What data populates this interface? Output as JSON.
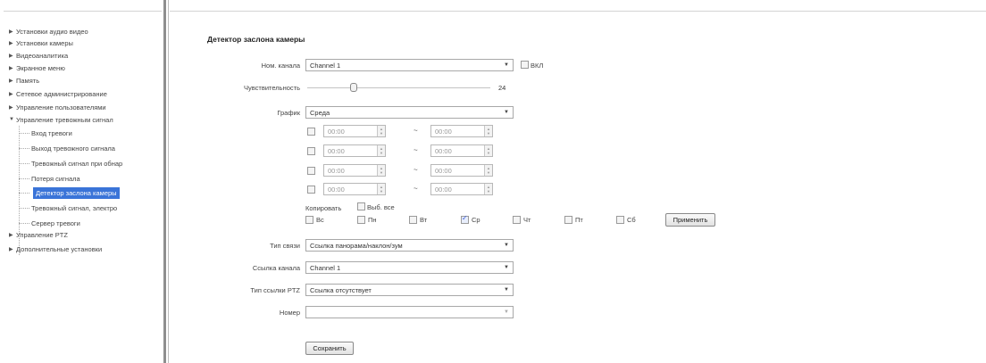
{
  "sidebar": {
    "items": [
      {
        "label": "Установки аудио видео"
      },
      {
        "label": "Установки камеры"
      },
      {
        "label": "Видеоаналитика"
      },
      {
        "label": "Экранное меню"
      },
      {
        "label": "Память"
      },
      {
        "label": "Сетевое администрирование"
      },
      {
        "label": "Управление пользователями"
      },
      {
        "label": "Управление тревожным сигнал"
      }
    ],
    "subitems": [
      {
        "label": "Вход тревоги"
      },
      {
        "label": "Выход тревожного сигнала"
      },
      {
        "label": "Тревожный сигнал при обнар"
      },
      {
        "label": "Потеря сигнала"
      },
      {
        "label": "Детектор заслона камеры"
      },
      {
        "label": "Тревожный сигнал, электро"
      },
      {
        "label": "Сервер тревоги"
      }
    ],
    "bottom_items": [
      {
        "label": "Управление PTZ"
      },
      {
        "label": "Дополнительные установки"
      }
    ],
    "active_subitem": "Детектор заслона камеры"
  },
  "form": {
    "title": "Детектор заслона камеры",
    "channel_label": "Ном. канала",
    "channel_value": "Channel 1",
    "enable_label": "ВКЛ",
    "sensitivity_label": "Чувствительность",
    "sensitivity_value": "24",
    "schedule_label": "График",
    "schedule_value": "Среда",
    "time_rows": [
      {
        "start": "00:00",
        "sep": "~",
        "end": "00:00"
      },
      {
        "start": "00:00",
        "sep": "~",
        "end": "00:00"
      },
      {
        "start": "00:00",
        "sep": "~",
        "end": "00:00"
      },
      {
        "start": "00:00",
        "sep": "~",
        "end": "00:00"
      }
    ],
    "copy_label": "Копировать",
    "select_all_label": "Выб. все",
    "days": [
      {
        "label": "Вс",
        "checked": false
      },
      {
        "label": "Пн",
        "checked": false
      },
      {
        "label": "Вт",
        "checked": false
      },
      {
        "label": "Ср",
        "checked": true
      },
      {
        "label": "Чт",
        "checked": false
      },
      {
        "label": "Пт",
        "checked": false
      },
      {
        "label": "Сб",
        "checked": false
      }
    ],
    "apply_label": "Применить",
    "link_type_label": "Тип связи",
    "link_type_value": "Ссылка панорама/наклон/зум",
    "channel_link_label": "Ссылка канала",
    "channel_link_value": "Channel 1",
    "ptz_link_label": "Тип ссылки PTZ",
    "ptz_link_value": "Ссылка отсутствует",
    "number_label": "Номер",
    "number_value": "",
    "save_label": "Сохранить"
  },
  "colors": {
    "active_bg": "#3a74d8",
    "separator": "#8e8e8e"
  },
  "slider": {
    "value": 24,
    "fraction": 0.24
  }
}
